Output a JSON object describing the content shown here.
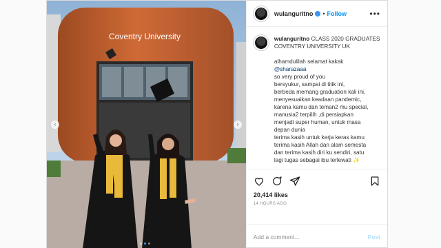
{
  "post": {
    "username": "wulanguritno",
    "follow_label": "Follow",
    "separator": "•",
    "more_label": "•••"
  },
  "photo": {
    "building_sign": "Coventry University"
  },
  "caption": {
    "username": "wulanguritno",
    "text": "CLASS 2020 GRADUATES\nCOVENTRY UNIVERSITY UK\n\nalhamdulilah selamat kakak\n",
    "mention": "@sharazaaa",
    "text2": "\nso very proud of you\nbersyukur, sampai di titik ini,\nberbeda memang graduation kali ini,\nmenyesuaikan keadaan pandemic,\nkarena kamu dan teman2 mu special,\nmanusia2 terpilih ,di persiapkan\nmenjadi super human, untuk masa\ndepan dunia\nterima kasih untuk kerja keras kamu\nterima kasih Allah dan alam semesta\ndan terima kasih diri ku sendiri, satu\nlagi tugas sebagai ibu terlewati ✨\n\ngraduation is only a concept"
  },
  "stats": {
    "likes": "20,414 likes",
    "time": "14 HOURS AGO"
  },
  "comment": {
    "placeholder": "Add a comment...",
    "post_label": "Post"
  },
  "nav": {
    "prev": "‹",
    "next": "›"
  },
  "colors": {
    "accent": "#0095f6",
    "building": "#c8602f",
    "gown": "#151515",
    "stole": "#e8b93a"
  }
}
